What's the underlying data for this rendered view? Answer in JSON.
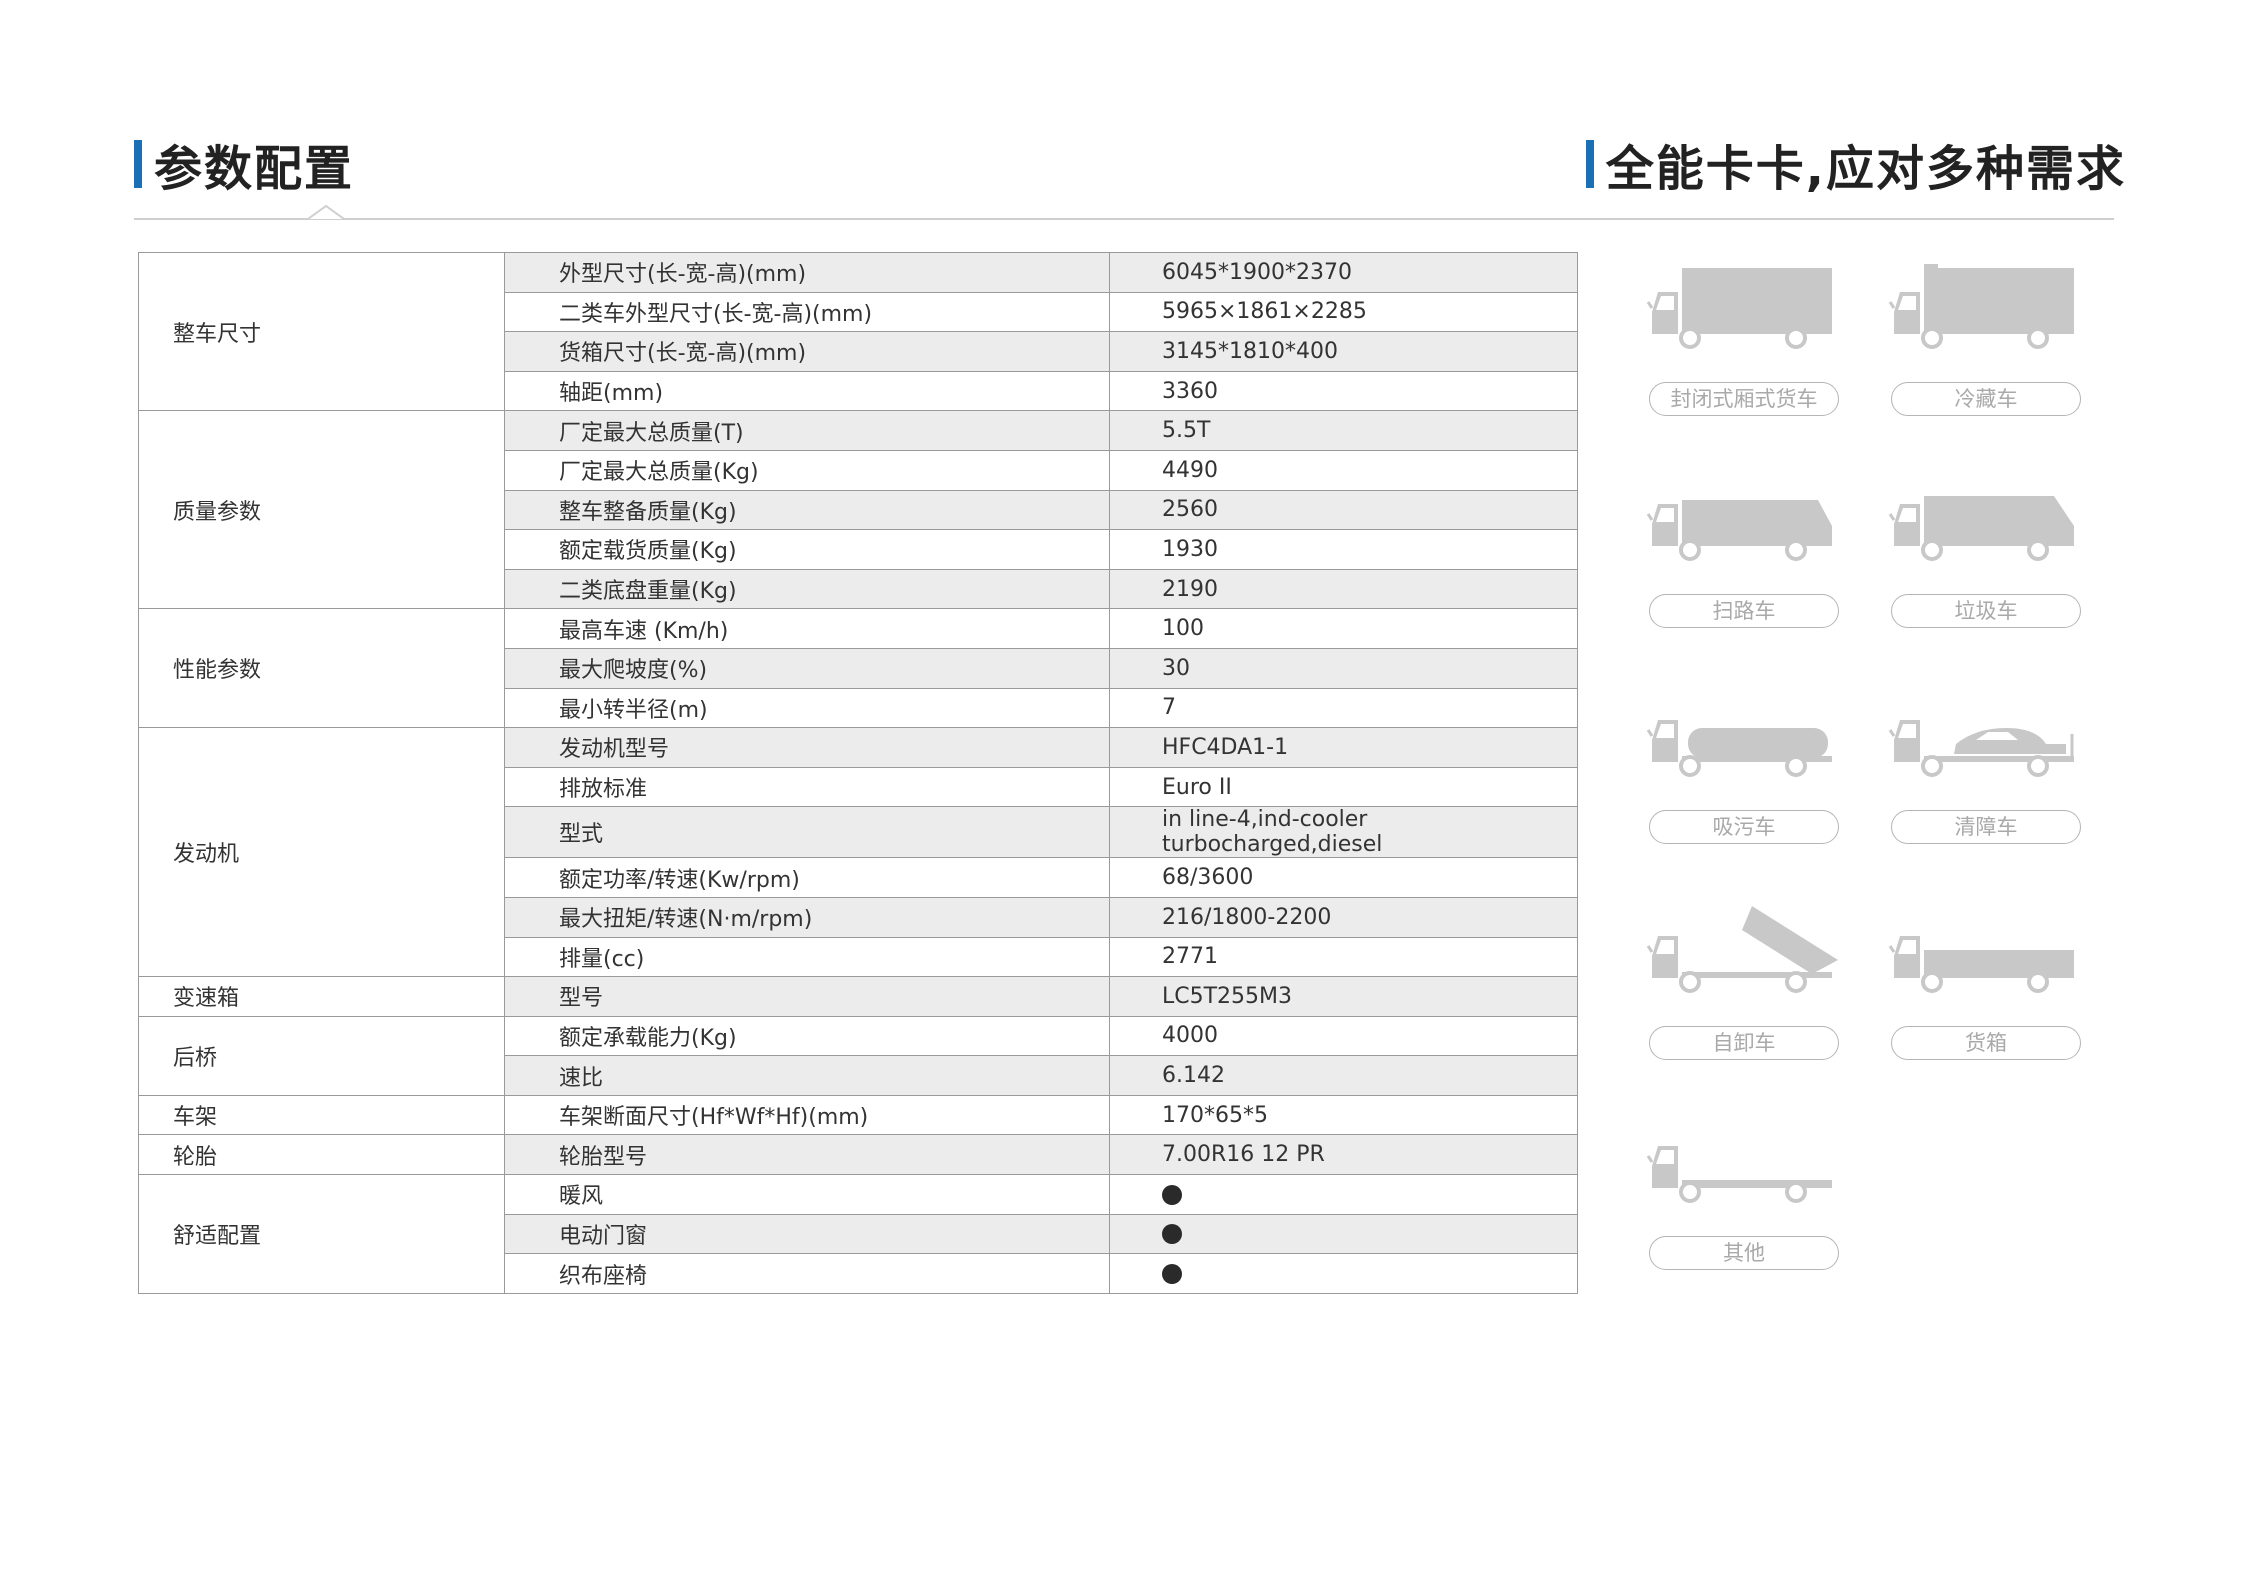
{
  "header": {
    "left_title": "参数配置",
    "right_title": "全能卡卡,应对多种需求"
  },
  "colors": {
    "accent": "#1a6fb5",
    "row_alt": "#ececec",
    "border": "#9a9a9a",
    "icon_gray": "#c8c8c8"
  },
  "specs": [
    {
      "category": "整车尺寸",
      "rows": [
        {
          "param": "外型尺寸(长-宽-高)(mm)",
          "value": "6045*1900*2370"
        },
        {
          "param": "二类车外型尺寸(长-宽-高)(mm)",
          "value": "5965×1861×2285"
        },
        {
          "param": "货箱尺寸(长-宽-高)(mm)",
          "value": "3145*1810*400"
        },
        {
          "param": "轴距(mm)",
          "value": "3360"
        }
      ]
    },
    {
      "category": "质量参数",
      "rows": [
        {
          "param": "厂定最大总质量(T)",
          "value": "5.5T"
        },
        {
          "param": "厂定最大总质量(Kg)",
          "value": "4490"
        },
        {
          "param": "整车整备质量(Kg)",
          "value": "2560"
        },
        {
          "param": "额定载货质量(Kg)",
          "value": "1930"
        },
        {
          "param": "二类底盘重量(Kg)",
          "value": "2190"
        }
      ]
    },
    {
      "category": "性能参数",
      "rows": [
        {
          "param": "最高车速 (Km/h)",
          "value": "100"
        },
        {
          "param": "最大爬坡度(%)",
          "value": "30"
        },
        {
          "param": "最小转半径(m)",
          "value": "7"
        }
      ]
    },
    {
      "category": "发动机",
      "rows": [
        {
          "param": "发动机型号",
          "value": "HFC4DA1-1"
        },
        {
          "param": "排放标准",
          "value": "Euro II"
        },
        {
          "param": "型式",
          "value": "in line-4,ind-cooler turbocharged,diesel"
        },
        {
          "param": "额定功率/转速(Kw/rpm)",
          "value": "68/3600"
        },
        {
          "param": "最大扭矩/转速(N·m/rpm)",
          "value": "216/1800-2200"
        },
        {
          "param": "排量(cc)",
          "value": "2771"
        }
      ]
    },
    {
      "category": "变速箱",
      "rows": [
        {
          "param": "型号",
          "value": "LC5T255M3"
        }
      ]
    },
    {
      "category": "后桥",
      "rows": [
        {
          "param": "额定承载能力(Kg)",
          "value": "4000"
        },
        {
          "param": "速比",
          "value": "6.142"
        }
      ]
    },
    {
      "category": "车架",
      "rows": [
        {
          "param": "车架断面尺寸(Hf*Wf*Hf)(mm)",
          "value": "170*65*5"
        }
      ]
    },
    {
      "category": "轮胎",
      "rows": [
        {
          "param": "轮胎型号",
          "value": "7.00R16 12 PR"
        }
      ]
    },
    {
      "category": "舒适配置",
      "rows": [
        {
          "param": "暖风",
          "value": "●"
        },
        {
          "param": "电动门窗",
          "value": "●"
        },
        {
          "param": "织布座椅",
          "value": "●"
        }
      ]
    }
  ],
  "vehicles": [
    {
      "label": "封闭式厢式货车",
      "icon": "box-truck-icon"
    },
    {
      "label": "冷藏车",
      "icon": "refrigerated-truck-icon"
    },
    {
      "label": "扫路车",
      "icon": "street-sweeper-icon"
    },
    {
      "label": "垃圾车",
      "icon": "garbage-truck-icon"
    },
    {
      "label": "吸污车",
      "icon": "sewage-suction-truck-icon"
    },
    {
      "label": "清障车",
      "icon": "tow-truck-icon"
    },
    {
      "label": "自卸车",
      "icon": "dump-truck-icon"
    },
    {
      "label": "货箱",
      "icon": "cargo-truck-icon"
    },
    {
      "label": "其他",
      "icon": "chassis-truck-icon"
    }
  ]
}
